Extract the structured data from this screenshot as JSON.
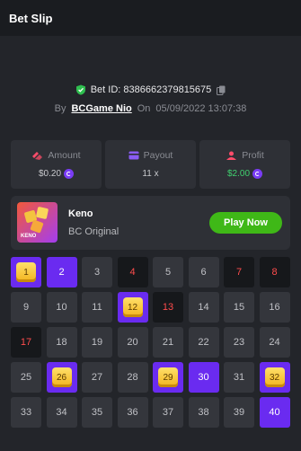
{
  "header": {
    "title": "Bet Slip"
  },
  "bet": {
    "id_label": "Bet ID: 8386662379815675",
    "by_label": "By",
    "user": "BCGame Nio",
    "on_label": "On",
    "datetime": "05/09/2022 13:07:38"
  },
  "stats": {
    "amount": {
      "label": "Amount",
      "value": "$0.20"
    },
    "payout": {
      "label": "Payout",
      "value": "11 x"
    },
    "profit": {
      "label": "Profit",
      "value": "$2.00"
    }
  },
  "game": {
    "name": "Keno",
    "subtitle": "BC Original",
    "thumb_label": "KENO",
    "play_label": "Play Now"
  },
  "colors": {
    "accent": "#6a2bf0",
    "play_green": "#3fb817",
    "miss_red": "#ff4c4c",
    "profit_green": "#40d16f"
  },
  "grid": {
    "cells": [
      {
        "n": "1",
        "state": "hit-sel"
      },
      {
        "n": "2",
        "state": "sel"
      },
      {
        "n": "3",
        "state": "normal"
      },
      {
        "n": "4",
        "state": "dark"
      },
      {
        "n": "5",
        "state": "normal"
      },
      {
        "n": "6",
        "state": "normal"
      },
      {
        "n": "7",
        "state": "dark"
      },
      {
        "n": "8",
        "state": "dark"
      },
      {
        "n": "9",
        "state": "normal"
      },
      {
        "n": "10",
        "state": "normal"
      },
      {
        "n": "11",
        "state": "normal"
      },
      {
        "n": "12",
        "state": "hit-sel"
      },
      {
        "n": "13",
        "state": "dark"
      },
      {
        "n": "14",
        "state": "normal"
      },
      {
        "n": "15",
        "state": "normal"
      },
      {
        "n": "16",
        "state": "normal"
      },
      {
        "n": "17",
        "state": "dark"
      },
      {
        "n": "18",
        "state": "normal"
      },
      {
        "n": "19",
        "state": "normal"
      },
      {
        "n": "20",
        "state": "normal"
      },
      {
        "n": "21",
        "state": "normal"
      },
      {
        "n": "22",
        "state": "normal"
      },
      {
        "n": "23",
        "state": "normal"
      },
      {
        "n": "24",
        "state": "normal"
      },
      {
        "n": "25",
        "state": "normal"
      },
      {
        "n": "26",
        "state": "hit-sel"
      },
      {
        "n": "27",
        "state": "normal"
      },
      {
        "n": "28",
        "state": "normal"
      },
      {
        "n": "29",
        "state": "hit-sel"
      },
      {
        "n": "30",
        "state": "sel"
      },
      {
        "n": "31",
        "state": "normal"
      },
      {
        "n": "32",
        "state": "hit-sel"
      },
      {
        "n": "33",
        "state": "normal"
      },
      {
        "n": "34",
        "state": "normal"
      },
      {
        "n": "35",
        "state": "normal"
      },
      {
        "n": "36",
        "state": "normal"
      },
      {
        "n": "37",
        "state": "normal"
      },
      {
        "n": "38",
        "state": "normal"
      },
      {
        "n": "39",
        "state": "normal"
      },
      {
        "n": "40",
        "state": "sel"
      }
    ]
  }
}
